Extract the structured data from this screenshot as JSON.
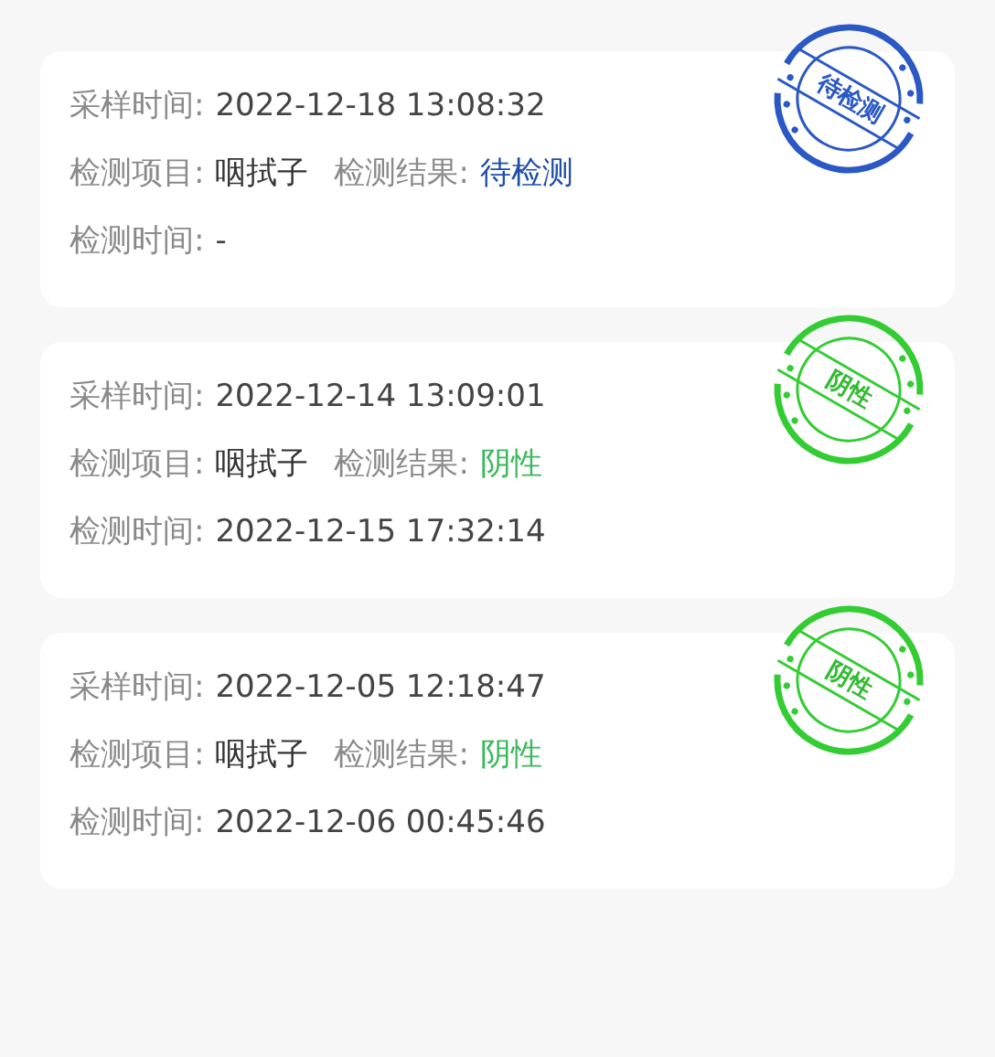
{
  "records": [
    {
      "sample_label": "采样时间:",
      "sample_time": "2022-12-18 13:08:32",
      "item_label": "检测项目:",
      "item": "咽拭子",
      "result_label": "检测结果:",
      "result": "待检测",
      "test_label": "检测时间:",
      "test_time": "-",
      "kind": "pending",
      "stamp": "待检测"
    },
    {
      "sample_label": "采样时间:",
      "sample_time": "2022-12-14 13:09:01",
      "item_label": "检测项目:",
      "item": "咽拭子",
      "result_label": "检测结果:",
      "result": "阴性",
      "test_label": "检测时间:",
      "test_time": "2022-12-15 17:32:14",
      "kind": "negative",
      "stamp": "阴性"
    },
    {
      "sample_label": "采样时间:",
      "sample_time": "2022-12-05 12:18:47",
      "item_label": "检测项目:",
      "item": "咽拭子",
      "result_label": "检测结果:",
      "result": "阴性",
      "test_label": "检测时间:",
      "test_time": "2022-12-06 00:45:46",
      "kind": "negative",
      "stamp": "阴性"
    }
  ]
}
